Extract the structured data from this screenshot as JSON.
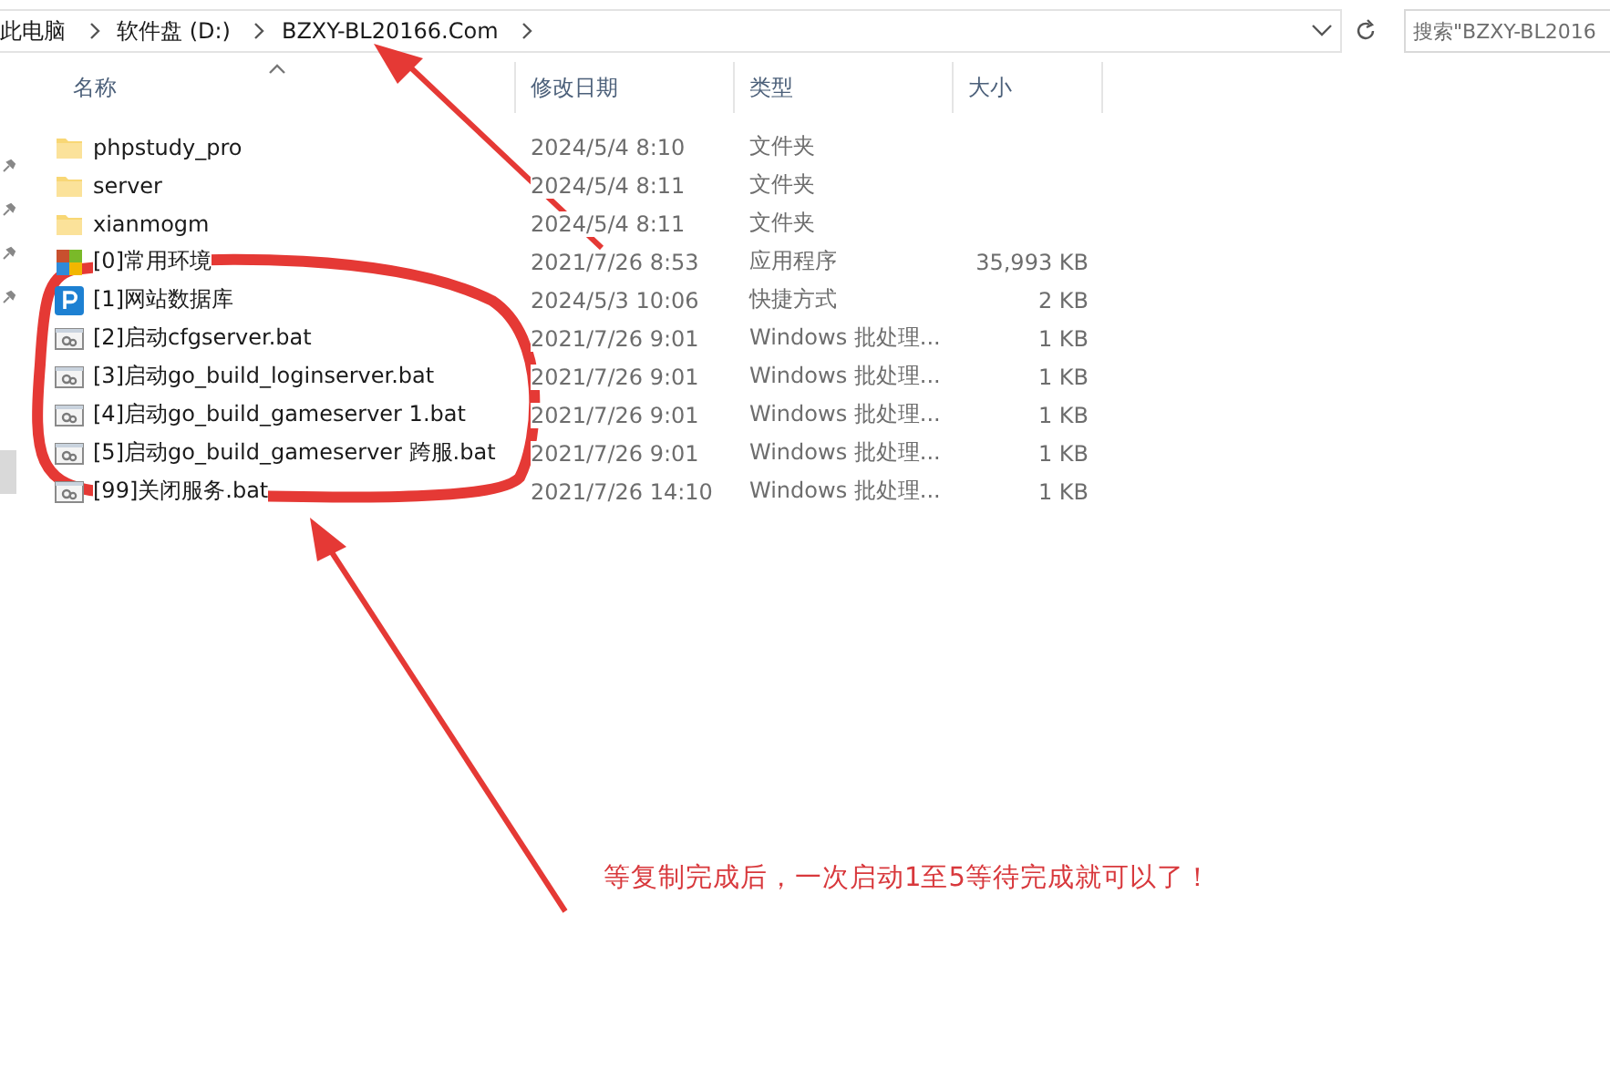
{
  "address_bar": {
    "crumbs": [
      "此电脑",
      "软件盘 (D:)",
      "BZXY-BL20166.Com"
    ]
  },
  "search": {
    "placeholder": "搜索\"BZXY-BL2016"
  },
  "nav_pane": {
    "items": [
      {
        "pinned": true,
        "selected": false
      },
      {
        "pinned": true,
        "selected": false
      },
      {
        "pinned": true,
        "selected": false
      },
      {
        "pinned": true,
        "selected": false
      },
      {
        "pinned": false,
        "selected": true
      }
    ]
  },
  "table": {
    "columns": [
      {
        "label": "名称",
        "sorted": true
      },
      {
        "label": "修改日期",
        "sorted": false
      },
      {
        "label": "类型",
        "sorted": false
      },
      {
        "label": "大小",
        "sorted": false
      }
    ],
    "rows": [
      {
        "kind": "folder",
        "name": "phpstudy_pro",
        "date": "2024/5/4 8:10",
        "type": "文件夹"
      },
      {
        "kind": "folder",
        "name": "server",
        "date": "2024/5/4 8:11",
        "type": "文件夹"
      },
      {
        "kind": "folder",
        "name": "xianmogm",
        "date": "2024/5/4 8:11",
        "type": "文件夹"
      },
      {
        "kind": "app",
        "name": "[0]常用环境",
        "date": "2021/7/26 8:53",
        "type": "应用程序",
        "size": "35,993 KB"
      },
      {
        "kind": "shortcut",
        "name": "[1]网站数据库",
        "date": "2024/5/3 10:06",
        "type": "快捷方式",
        "size": "2 KB"
      },
      {
        "kind": "batch",
        "name": "[2]启动cfgserver.bat",
        "date": "2021/7/26 9:01",
        "type": "Windows 批处理...",
        "size": "1 KB"
      },
      {
        "kind": "batch",
        "name": "[3]启动go_build_loginserver.bat",
        "date": "2021/7/26 9:01",
        "type": "Windows 批处理...",
        "size": "1 KB"
      },
      {
        "kind": "batch",
        "name": "[4]启动go_build_gameserver 1.bat",
        "date": "2021/7/26 9:01",
        "type": "Windows 批处理...",
        "size": "1 KB"
      },
      {
        "kind": "batch",
        "name": "[5]启动go_build_gameserver 跨服.bat",
        "date": "2021/7/26 9:01",
        "type": "Windows 批处理...",
        "size": "1 KB"
      },
      {
        "kind": "batch",
        "name": "[99]关闭服务.bat",
        "date": "2021/7/26 14:10",
        "type": "Windows 批处理...",
        "size": "1 KB"
      }
    ]
  },
  "annotation": {
    "text": "等复制完成后，一次启动1至5等待完成就可以了！"
  }
}
